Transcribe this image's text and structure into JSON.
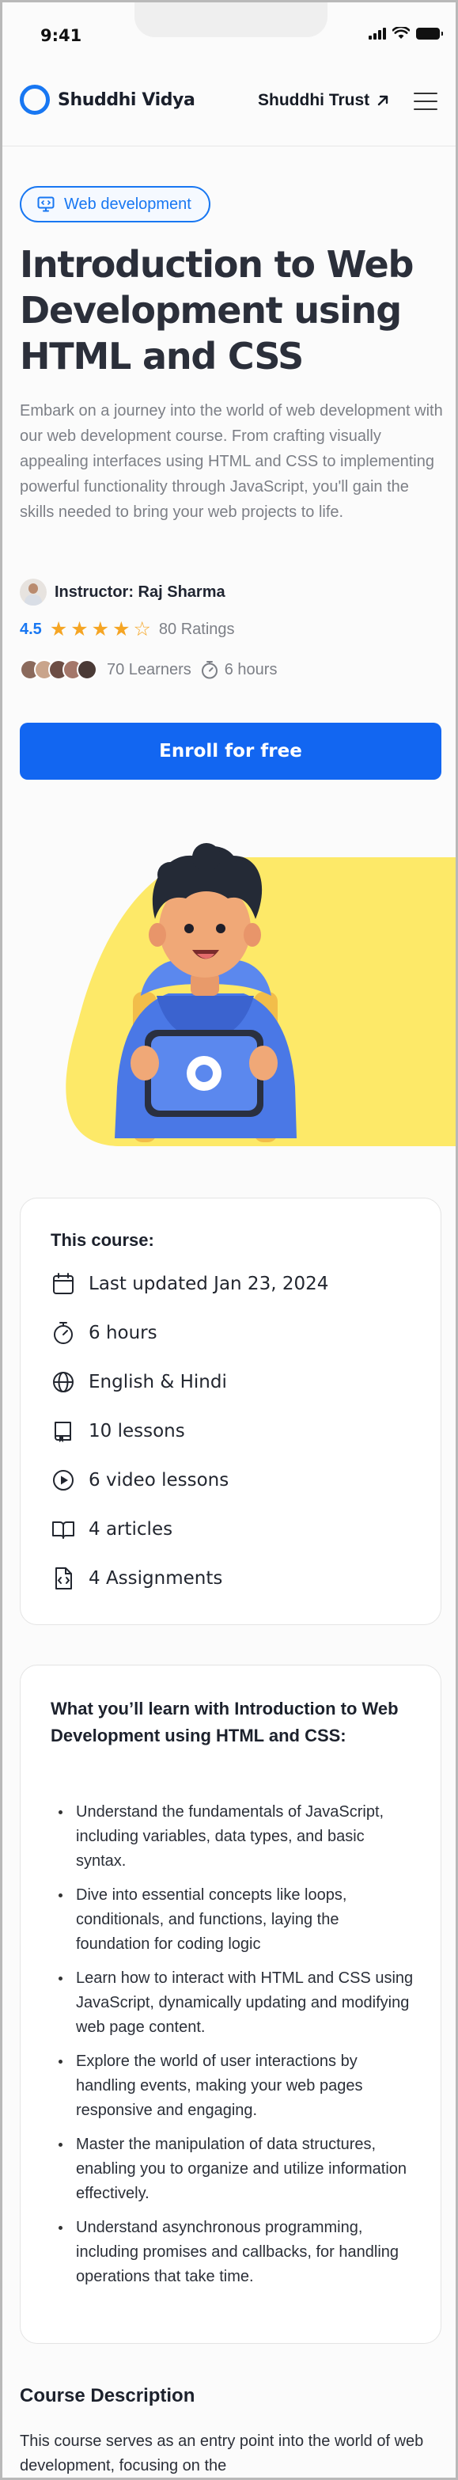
{
  "status": {
    "time": "9:41"
  },
  "header": {
    "brand": "Shuddhi Vidya",
    "trust_link": "Shuddhi Trust"
  },
  "hero": {
    "tag": "Web development",
    "title": "Introduction to Web Development using HTML and CSS",
    "description": "Embark on a journey into the world of web development with our web development course. From crafting visually appealing interfaces using HTML and CSS to implementing powerful functionality through JavaScript, you'll gain the skills needed to bring your web projects to life.",
    "instructor": "Instructor: Raj Sharma",
    "rating_value": "4.5",
    "rating_stars": 4,
    "rating_count": "80 Ratings",
    "learners": "70 Learners",
    "duration": "6 hours",
    "enroll_label": "Enroll for free"
  },
  "course_card": {
    "title": "This course:",
    "features": [
      {
        "icon": "calendar-icon",
        "text": "Last updated Jan 23, 2024"
      },
      {
        "icon": "timer-icon",
        "text": "6 hours"
      },
      {
        "icon": "globe-icon",
        "text": "English & Hindi"
      },
      {
        "icon": "book-icon",
        "text": "10 lessons"
      },
      {
        "icon": "play-icon",
        "text": "6 video lessons"
      },
      {
        "icon": "open-book-icon",
        "text": "4 articles"
      },
      {
        "icon": "code-file-icon",
        "text": "4 Assignments"
      }
    ]
  },
  "learn_card": {
    "title": "What you’ll learn with Introduction to Web Development using HTML and CSS:",
    "items": [
      "Understand the fundamentals of JavaScript, including variables, data types, and basic syntax.",
      "Dive into essential concepts like loops, conditionals, and functions, laying the foundation for coding logic",
      "Learn how to interact with HTML and CSS using JavaScript, dynamically updating and modifying web page content.",
      "Explore the world of user interactions by handling events, making your web pages responsive and engaging.",
      "Master the manipulation of data structures, enabling you to organize and utilize information effectively.",
      "Understand asynchronous programming, including promises and callbacks, for handling operations that take time."
    ]
  },
  "course_description": {
    "title": "Course Description",
    "text": "This course serves as an entry point into the world of web development, focusing on the"
  },
  "colors": {
    "accent": "#1877f2",
    "button": "#1266f1",
    "star": "#f5a524",
    "illustration_bg": "#fde968"
  }
}
